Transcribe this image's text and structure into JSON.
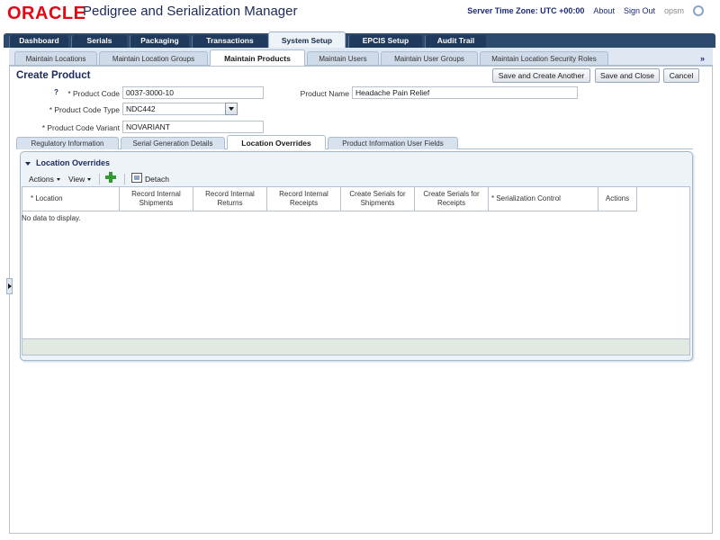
{
  "header": {
    "logo": "ORACLE",
    "app_title": "Pedigree and Serialization Manager",
    "server_time": "Server Time Zone: UTC +00:00",
    "about": "About",
    "sign_out": "Sign Out",
    "user": "opsm"
  },
  "main_tabs": [
    {
      "label": "Dashboard",
      "active": false
    },
    {
      "label": "Serials",
      "active": false
    },
    {
      "label": "Packaging",
      "active": false
    },
    {
      "label": "Transactions",
      "active": false
    },
    {
      "label": "System Setup",
      "active": true
    },
    {
      "label": "EPCIS Setup",
      "active": false
    },
    {
      "label": "Audit Trail",
      "active": false
    }
  ],
  "sub_tabs": [
    {
      "label": "Maintain Locations",
      "active": false
    },
    {
      "label": "Maintain Location Groups",
      "active": false
    },
    {
      "label": "Maintain Products",
      "active": true
    },
    {
      "label": "Maintain Users",
      "active": false
    },
    {
      "label": "Maintain User Groups",
      "active": false
    },
    {
      "label": "Maintain Location Security Roles",
      "active": false
    }
  ],
  "overflow": "»",
  "page": {
    "title": "Create Product",
    "buttons": {
      "save_and_create_another": "Save and Create Another",
      "save_and_close": "Save and Close",
      "cancel": "Cancel"
    },
    "help": "?",
    "form": {
      "product_code_label": "* Product Code",
      "product_code_value": "0037-3000-10",
      "product_code_type_label": "* Product Code Type",
      "product_code_type_value": "NDC442",
      "product_code_variant_label": "* Product Code Variant",
      "product_code_variant_value": "NOVARIANT",
      "product_name_label": "Product Name",
      "product_name_value": "Headache Pain Relief"
    }
  },
  "inner_tabs": [
    {
      "label": "Regulatory Information",
      "active": false
    },
    {
      "label": "Serial Generation Details",
      "active": false
    },
    {
      "label": "Location Overrides",
      "active": true
    },
    {
      "label": "Product Information User Fields",
      "active": false
    }
  ],
  "location_overrides": {
    "title": "Location Overrides",
    "toolbar": {
      "actions": "Actions",
      "view": "View",
      "detach": "Detach"
    },
    "columns": [
      "* Location",
      "Record Internal Shipments",
      "Record Internal Returns",
      "Record Internal Receipts",
      "Create Serials for Shipments",
      "Create Serials for Receipts",
      "* Serialization Control",
      "Actions"
    ],
    "empty_message": "No data to display."
  }
}
